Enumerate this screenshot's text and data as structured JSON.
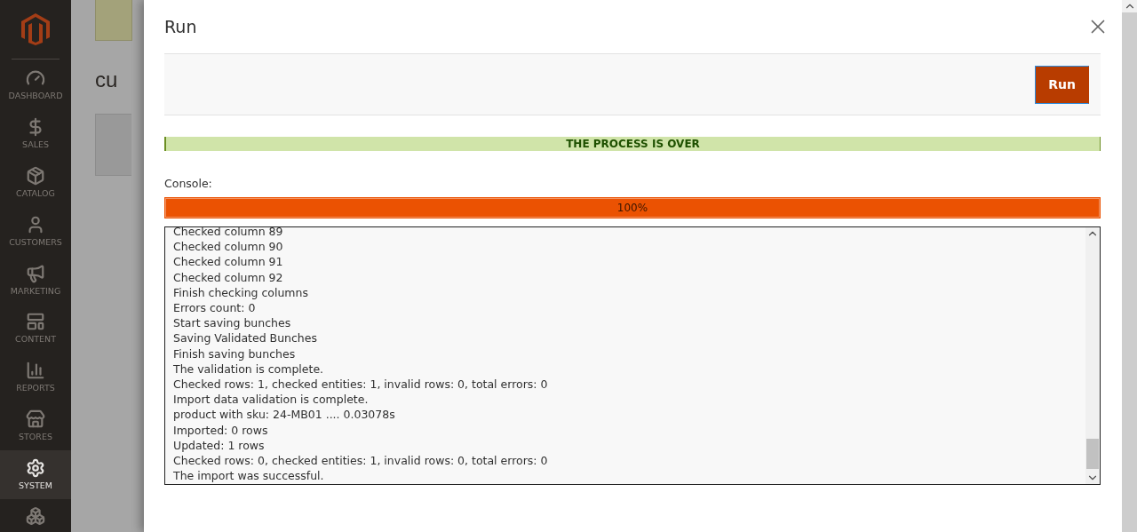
{
  "sidebar": {
    "items": [
      {
        "kind": "dashboard",
        "label": "DASHBOARD",
        "selected": false
      },
      {
        "kind": "sales",
        "label": "SALES",
        "selected": false
      },
      {
        "kind": "catalog",
        "label": "CATALOG",
        "selected": false
      },
      {
        "kind": "customers",
        "label": "CUSTOMERS",
        "selected": false
      },
      {
        "kind": "marketing",
        "label": "MARKETING",
        "selected": false
      },
      {
        "kind": "content",
        "label": "CONTENT",
        "selected": false
      },
      {
        "kind": "reports",
        "label": "REPORTS",
        "selected": false
      },
      {
        "kind": "stores",
        "label": "STORES",
        "selected": false
      },
      {
        "kind": "system",
        "label": "SYSTEM",
        "selected": true
      }
    ]
  },
  "page": {
    "heading": "cu"
  },
  "modal": {
    "title": "Run",
    "run_button": "Run",
    "status": "THE PROCESS IS OVER",
    "console_label": "Console:",
    "progress": {
      "level": 1,
      "reading": "100%"
    },
    "console_lines": [
      "Checked column 89",
      "Checked column 90",
      "Checked column 91",
      "Checked column 92",
      "Finish checking columns",
      "Errors count: 0",
      "Start saving bunches",
      "Saving Validated Bunches",
      "Finish saving bunches",
      "The validation is complete.",
      "Checked rows: 1, checked entities: 1, invalid rows: 0, total errors: 0",
      "Import data validation is complete.",
      "product with sku: 24-MB01 .... 0.03078s",
      "Imported: 0 rows",
      "Updated: 1 rows",
      "Checked rows: 0, checked entities: 1, invalid rows: 0, total errors: 0",
      "The import was successful."
    ]
  }
}
